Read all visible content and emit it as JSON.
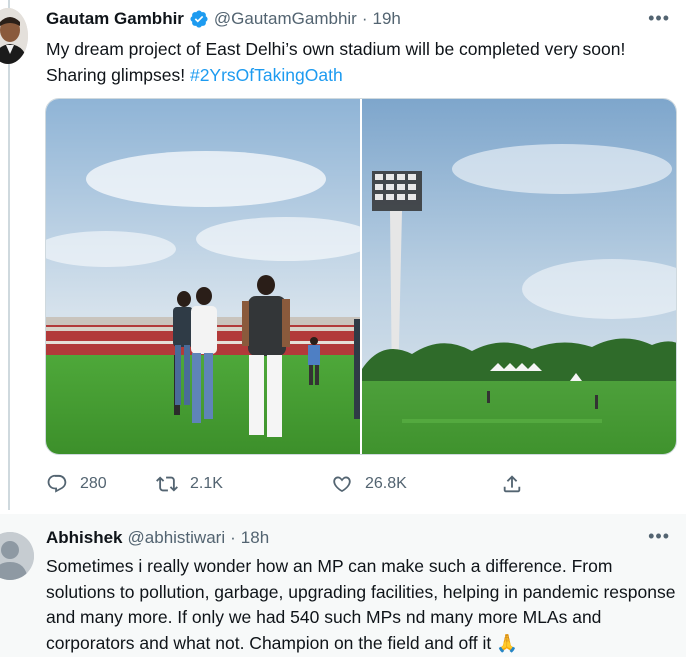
{
  "tweet": {
    "author_name": "Gautam Gambhir",
    "author_handle": "@GautamGambhir",
    "separator": "·",
    "time": "19h",
    "more_label": "•••",
    "text": "My dream project of East Delhi’s own stadium will be completed very soon! Sharing glimpses! ",
    "hashtag": "#2YrsOfTakingOath",
    "verified": true,
    "actions": {
      "reply_count": "280",
      "retweet_count": "2.1K",
      "like_count": "26.8K"
    }
  },
  "reply": {
    "author_name": "Abhishek",
    "author_handle": "@abhistiwari",
    "separator": "·",
    "time": "18h",
    "more_label": "•••",
    "text": "Sometimes i really wonder how an MP can make such a difference. From solutions to pollution, garbage, upgrading facilities, helping in pandemic response and many more. If only we had 540 such MPs nd many more MLAs and corporators and what not. Champion on the field and off it ",
    "emoji": "🙏"
  },
  "colors": {
    "accent": "#1d9bf0",
    "secondary_text": "#536471",
    "grass": "#3f9a2c",
    "sky": "#a9c9e4"
  },
  "icons": [
    "verified-badge-icon",
    "reply-icon",
    "retweet-icon",
    "like-icon",
    "share-icon",
    "more-icon"
  ]
}
